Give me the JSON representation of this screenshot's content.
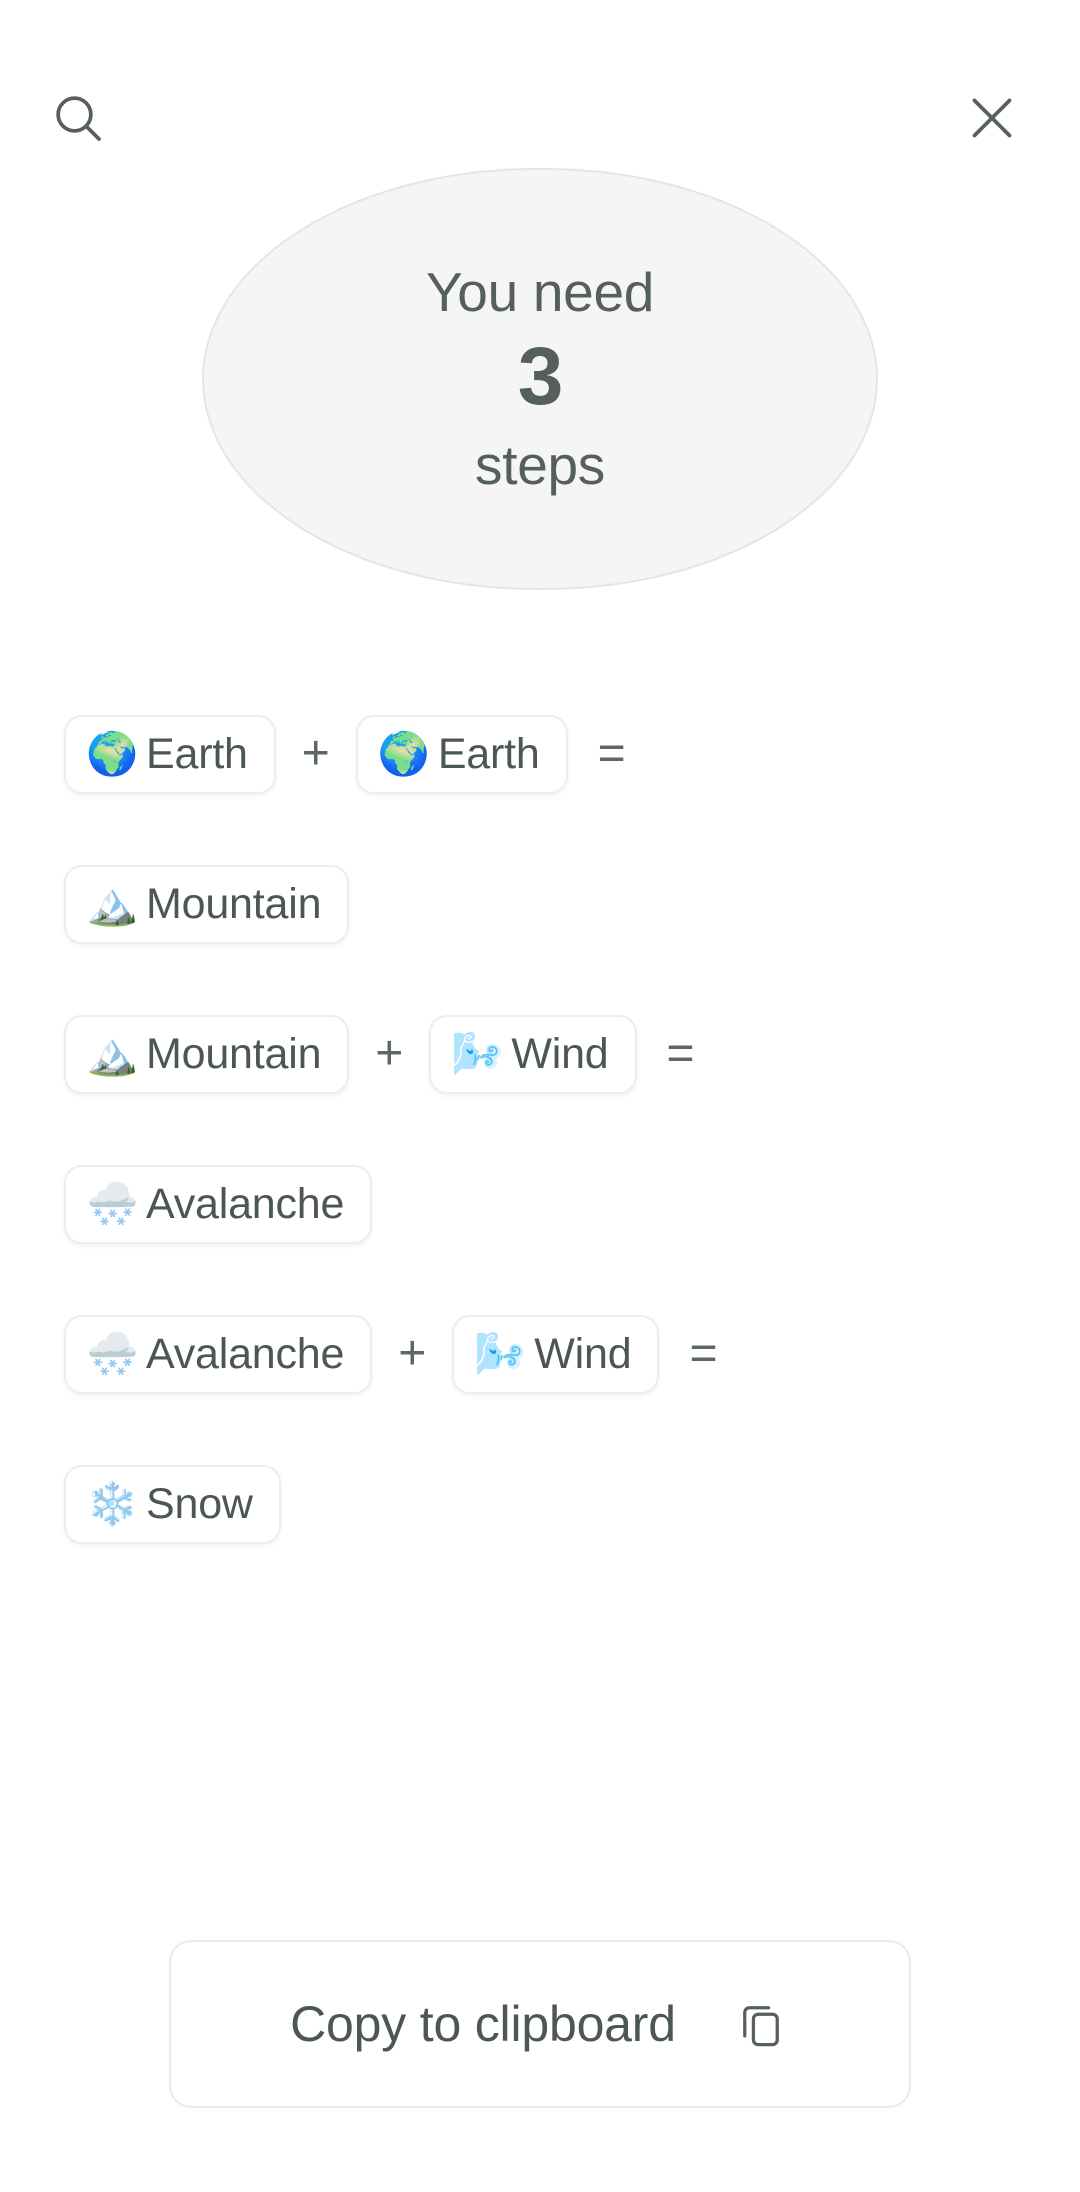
{
  "header": {
    "search_icon": "search-icon",
    "close_icon": "close-icon"
  },
  "hero": {
    "line1": "You need",
    "count": "3",
    "line2": "steps"
  },
  "operators": {
    "plus": "+",
    "equals": "="
  },
  "recipes": [
    {
      "type": "combine",
      "a": {
        "emoji": "🌍",
        "emoji_name": "earth-globe-europe-africa",
        "label": "Earth"
      },
      "b": {
        "emoji": "🌍",
        "emoji_name": "earth-globe-europe-africa",
        "label": "Earth"
      }
    },
    {
      "type": "result",
      "a": {
        "emoji": "🏔️",
        "emoji_name": "snow-capped-mountain",
        "label": "Mountain"
      }
    },
    {
      "type": "combine",
      "a": {
        "emoji": "🏔️",
        "emoji_name": "snow-capped-mountain",
        "label": "Mountain"
      },
      "b": {
        "emoji": "🌬️",
        "emoji_name": "wind-face",
        "label": "Wind"
      }
    },
    {
      "type": "result",
      "a": {
        "emoji": "🌨️",
        "emoji_name": "cloud-with-snow",
        "label": "Avalanche"
      }
    },
    {
      "type": "combine",
      "a": {
        "emoji": "🌨️",
        "emoji_name": "cloud-with-snow",
        "label": "Avalanche"
      },
      "b": {
        "emoji": "🌬️",
        "emoji_name": "wind-face",
        "label": "Wind"
      }
    },
    {
      "type": "result",
      "a": {
        "emoji": "❄️",
        "emoji_name": "snowflake",
        "label": "Snow"
      }
    }
  ],
  "footer": {
    "copy_label": "Copy to clipboard",
    "copy_icon": "copy-icon"
  },
  "colors": {
    "background": "#ffffff",
    "hero_fill": "#f4f5f4",
    "hero_border": "#e4e6e4",
    "text": "#4c5653",
    "muted_text": "#555f5b",
    "chip_border": "#ededed",
    "button_border": "#e9eae9"
  }
}
